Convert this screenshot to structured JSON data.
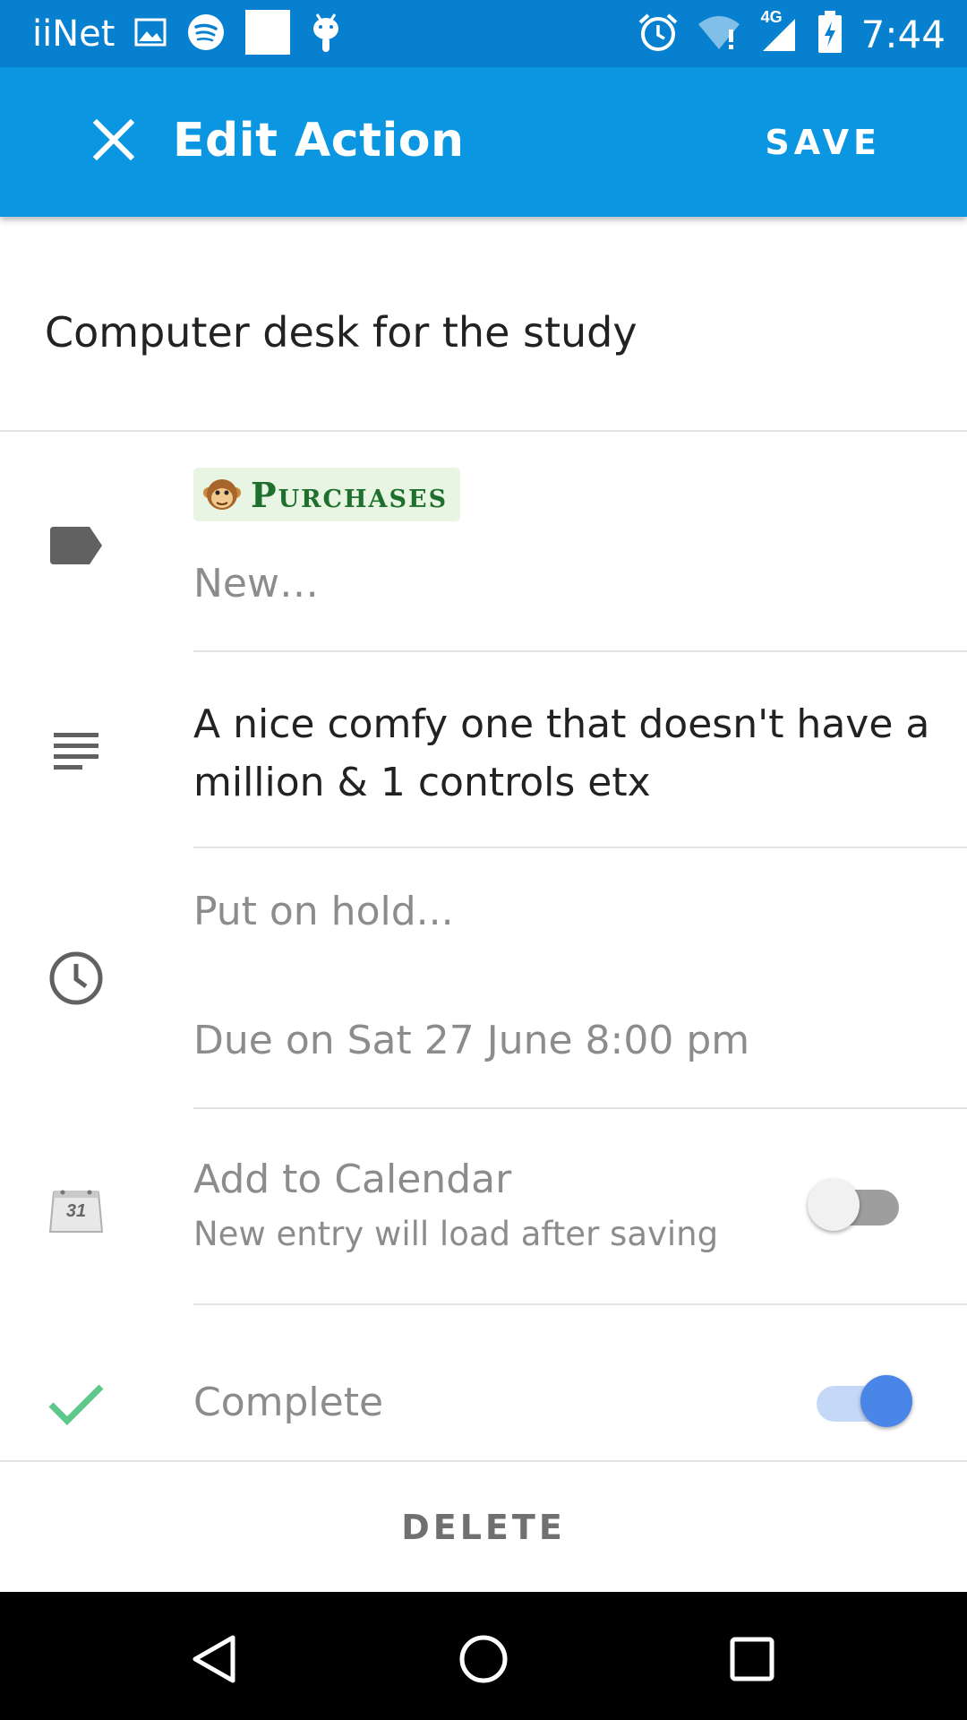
{
  "status_bar": {
    "carrier": "iiNet",
    "time": "7:44",
    "network_label": "4G",
    "icons": [
      "image-icon",
      "spotify-icon",
      "square-icon",
      "android-icon",
      "alarm-icon",
      "wifi-icon",
      "signal-icon",
      "battery-charging-icon"
    ]
  },
  "app_bar": {
    "title": "Edit Action",
    "save_label": "SAVE",
    "close_icon": "close-icon",
    "color": "#0a96e0"
  },
  "action": {
    "title": "Computer desk for the study"
  },
  "tags": {
    "icon": "label-icon",
    "chips": [
      {
        "label": "Purchases",
        "icon": "monkey-face-icon"
      }
    ],
    "new_placeholder": "New…"
  },
  "details": {
    "icon": "notes-icon",
    "text_line1": "A nice comfy one that doesn't have a",
    "text_line2": "million & 1 controls etx"
  },
  "schedule": {
    "icon": "clock-icon",
    "hold_label": "Put on hold...",
    "due_label": "Due on Sat 27 June 8:00 pm"
  },
  "calendar": {
    "icon": "calendar-icon",
    "icon_text": "31",
    "title": "Add to Calendar",
    "subtitle": "New entry will load after saving",
    "enabled": false
  },
  "complete": {
    "icon": "check-icon",
    "label": "Complete",
    "enabled": true,
    "accent": "#4a86e8"
  },
  "delete_label": "DELETE",
  "nav_bar": {
    "buttons": [
      "back-icon",
      "home-icon",
      "recents-icon"
    ]
  }
}
